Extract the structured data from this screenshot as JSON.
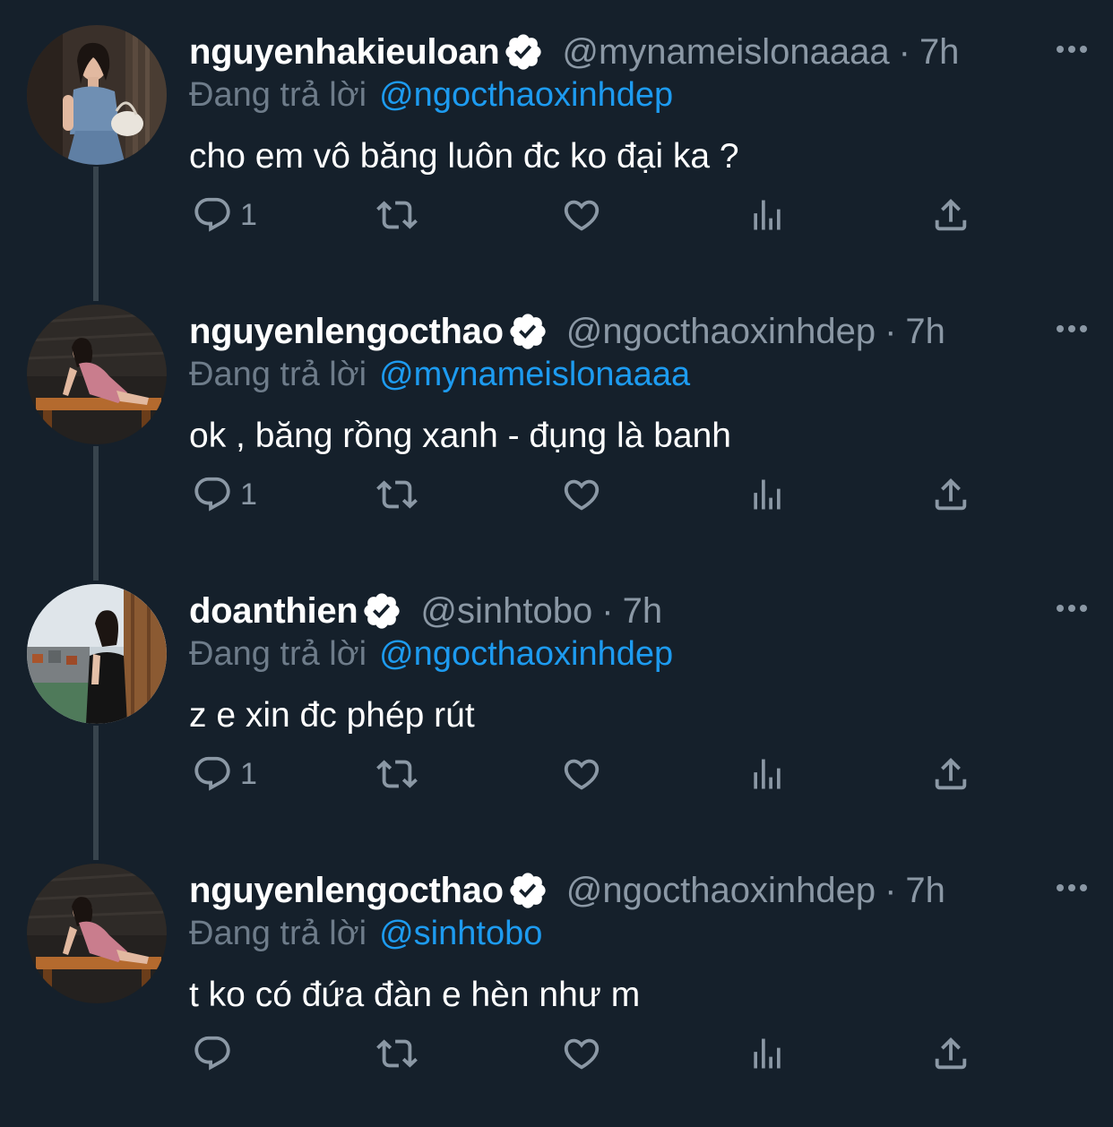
{
  "theme": {
    "background": "#15202b",
    "text_primary": "#ffffff",
    "text_secondary": "#8b98a5",
    "link": "#1d9bf0",
    "verified_badge": "#ffffff",
    "thread_line": "#38444d"
  },
  "tweets": [
    {
      "display_name": "nguyenhakieuloan",
      "verified": true,
      "handle": "@mynameislonaaaa",
      "separator": "·",
      "time": "7h",
      "reply_prefix": "Đang trả lời",
      "reply_to": "@ngocthaoxinhdep",
      "text": "cho em vô băng luôn đc ko đại ka ?",
      "reply_count": "1",
      "avatar_icon": "profile-photo-woman-denim",
      "actions": [
        "reply-icon",
        "retweet-icon",
        "like-icon",
        "views-icon",
        "share-icon"
      ]
    },
    {
      "display_name": "nguyenlengocthao",
      "verified": true,
      "handle": "@ngocthaoxinhdep",
      "separator": "·",
      "time": "7h",
      "reply_prefix": "Đang trả lời",
      "reply_to": "@mynameislonaaaa",
      "text": "ok , băng rồng xanh - đụng là banh",
      "reply_count": "1",
      "avatar_icon": "profile-photo-woman-pink-dress",
      "actions": [
        "reply-icon",
        "retweet-icon",
        "like-icon",
        "views-icon",
        "share-icon"
      ]
    },
    {
      "display_name": "doanthien",
      "verified": true,
      "handle": "@sinhtobo",
      "separator": "·",
      "time": "7h",
      "reply_prefix": "Đang trả lời",
      "reply_to": "@ngocthaoxinhdep",
      "text": "z e xin đc phép rút",
      "reply_count": "1",
      "avatar_icon": "profile-photo-woman-black-dress",
      "actions": [
        "reply-icon",
        "retweet-icon",
        "like-icon",
        "views-icon",
        "share-icon"
      ]
    },
    {
      "display_name": "nguyenlengocthao",
      "verified": true,
      "handle": "@ngocthaoxinhdep",
      "separator": "·",
      "time": "7h",
      "reply_prefix": "Đang trả lời",
      "reply_to": "@sinhtobo",
      "text": "t ko có đứa đàn e hèn như m",
      "reply_count": "",
      "avatar_icon": "profile-photo-woman-pink-dress",
      "actions": [
        "reply-icon",
        "retweet-icon",
        "like-icon",
        "views-icon",
        "share-icon"
      ]
    }
  ]
}
